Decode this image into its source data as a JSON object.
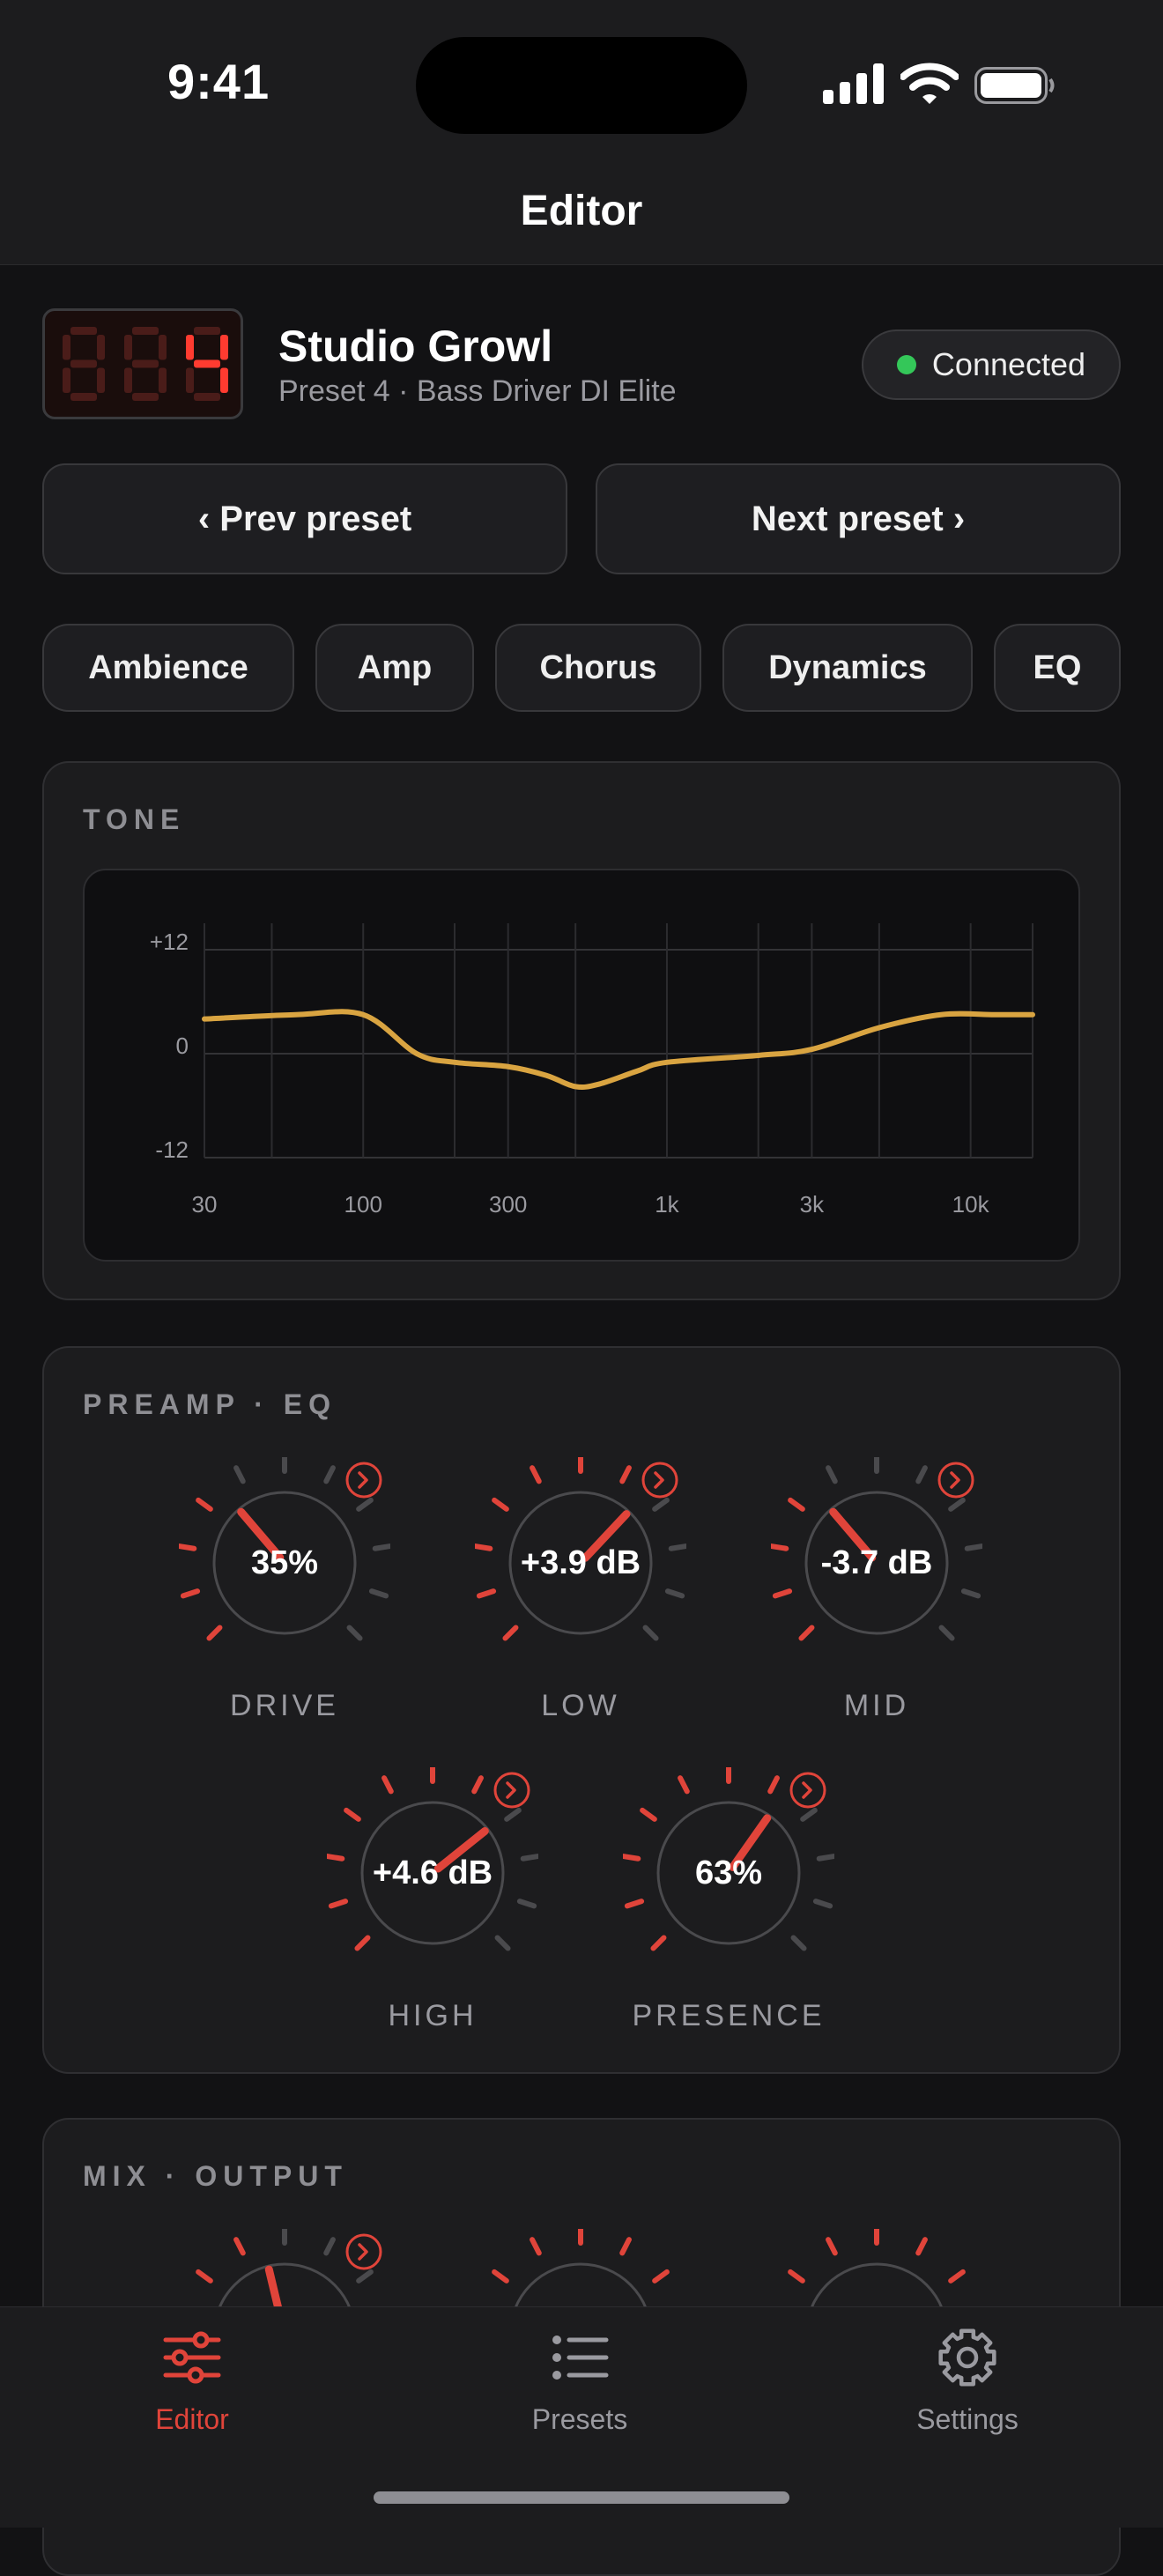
{
  "status": {
    "time": "9:41"
  },
  "nav": {
    "title": "Editor"
  },
  "preset": {
    "number_display": "004",
    "name": "Studio Growl",
    "subtitle": "Preset 4 · Bass Driver DI Elite",
    "connection": "Connected",
    "connection_color": "#34c759"
  },
  "buttons": {
    "prev": "‹ Prev preset",
    "next": "Next preset ›"
  },
  "chips": [
    "Ambience",
    "Amp",
    "Chorus",
    "Dynamics",
    "EQ"
  ],
  "tone": {
    "title": "TONE",
    "y_ticks": [
      "+12",
      "0",
      "-12"
    ],
    "x_ticks": [
      "30",
      "100",
      "300",
      "1k",
      "3k",
      "10k"
    ],
    "curve_color": "#d9a441"
  },
  "chart_data": {
    "type": "line",
    "x_scale": "log",
    "xlim": [
      30,
      16000
    ],
    "ylim": [
      -12,
      12
    ],
    "y_tick_labels": [
      "+12",
      "0",
      "-12"
    ],
    "x_tick_labels": [
      "30",
      "100",
      "300",
      "1k",
      "3k",
      "10k"
    ],
    "grid": true,
    "series": [
      {
        "x": [
          30,
          60,
          100,
          150,
          200,
          300,
          400,
          500,
          600,
          800,
          1000,
          2000,
          3000,
          5000,
          8000,
          12000,
          16000
        ],
        "y": [
          4.0,
          4.5,
          4.5,
          0.0,
          -1.0,
          -1.5,
          -2.5,
          -3.8,
          -3.5,
          -2.0,
          -1.0,
          -0.2,
          0.5,
          3.0,
          4.5,
          4.5,
          4.5
        ]
      }
    ]
  },
  "preamp": {
    "title": "PREAMP · EQ",
    "knobs": [
      {
        "label": "DRIVE",
        "value": "35%",
        "level": 0.35
      },
      {
        "label": "LOW",
        "value": "+3.9 dB",
        "level": 0.66
      },
      {
        "label": "MID",
        "value": "-3.7 dB",
        "level": 0.35
      },
      {
        "label": "HIGH",
        "value": "+4.6 dB",
        "level": 0.69
      },
      {
        "label": "PRESENCE",
        "value": "63%",
        "level": 0.63
      }
    ]
  },
  "mix": {
    "title": "MIX · OUTPUT"
  },
  "tabs": [
    {
      "label": "Editor",
      "icon": "sliders-icon",
      "active": true
    },
    {
      "label": "Presets",
      "icon": "list-icon",
      "active": false
    },
    {
      "label": "Settings",
      "icon": "gear-icon",
      "active": false
    }
  ],
  "colors": {
    "accent": "#e0443a",
    "background": "#121214",
    "card": "#1c1c1e"
  }
}
